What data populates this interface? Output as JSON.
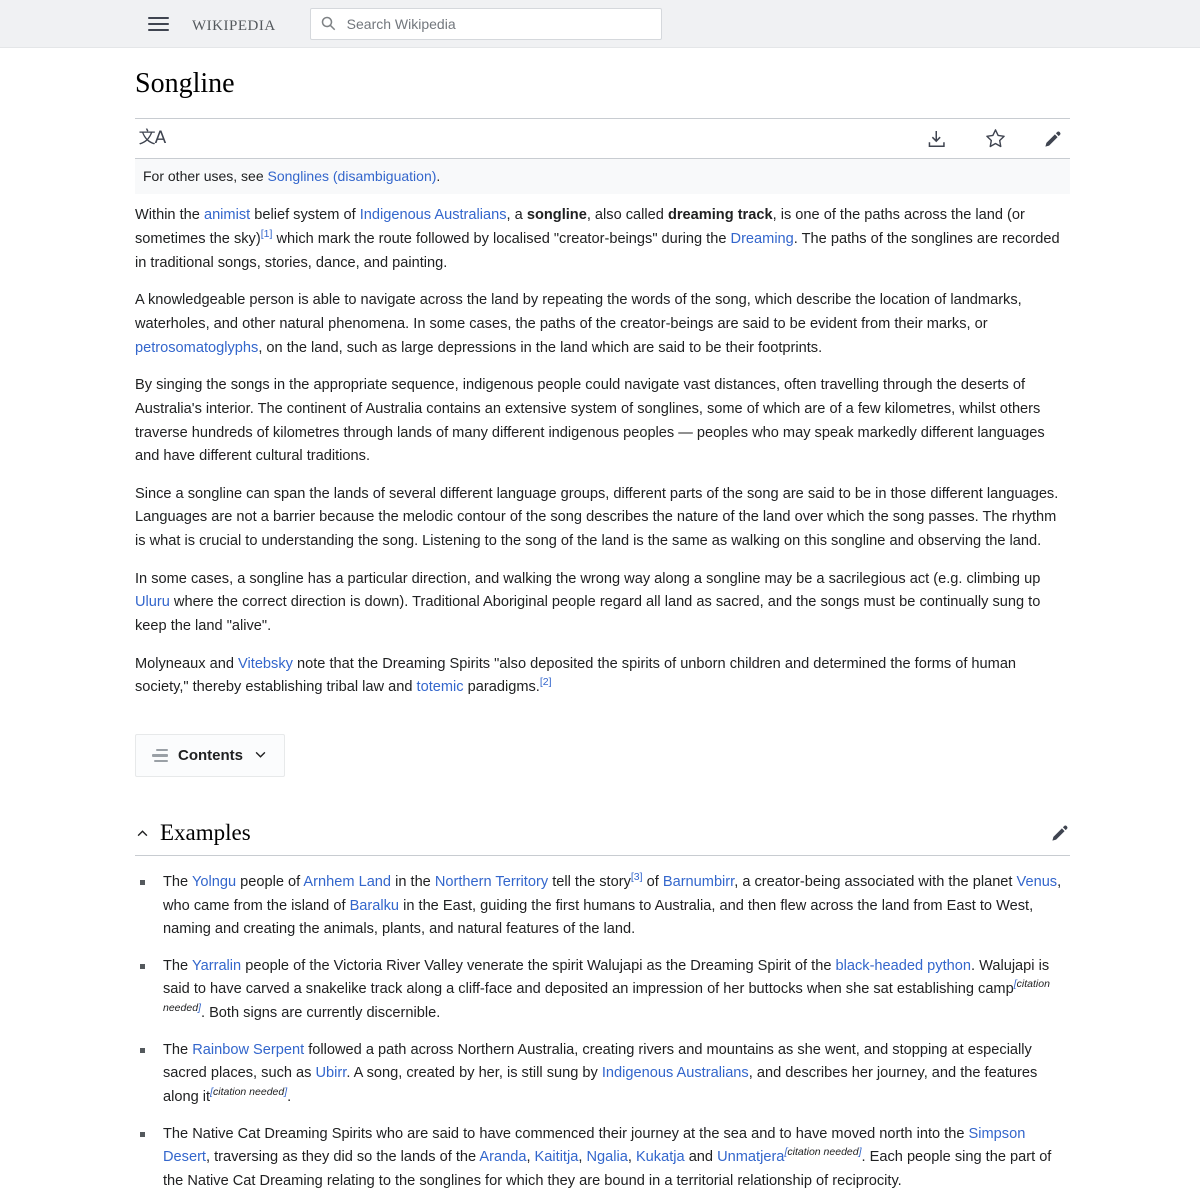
{
  "header": {
    "menu_icon": "hamburger-menu-icon",
    "wordmark": "Wikipedia",
    "search": {
      "icon": "search-icon",
      "placeholder": "Search Wikipedia",
      "value": ""
    }
  },
  "article": {
    "title": "Songline",
    "toolbar": {
      "language_button_label": "文A",
      "language_icon": "translate-language-icon",
      "download_icon": "download-icon",
      "watch_icon": "star-watch-icon",
      "edit_icon": "edit-pencil-icon"
    },
    "hatnote": {
      "prefix": "For other uses, see ",
      "link": "Songlines (disambiguation)",
      "suffix": "."
    },
    "paragraphs": [
      {
        "id": "lead",
        "segments": [
          {
            "t": "Within the ",
            "k": "text"
          },
          {
            "t": "animist",
            "k": "link"
          },
          {
            "t": " belief system of ",
            "k": "text"
          },
          {
            "t": "Indigenous Australians",
            "k": "link"
          },
          {
            "t": ", a ",
            "k": "text"
          },
          {
            "t": "songline",
            "k": "bold"
          },
          {
            "t": ", also called ",
            "k": "text"
          },
          {
            "t": "dreaming track",
            "k": "bold"
          },
          {
            "t": ", is one of the paths across the land (or sometimes the sky)",
            "k": "text"
          },
          {
            "t": "[1]",
            "k": "ref"
          },
          {
            "t": " which mark the route followed by localised \"creator-beings\" during the ",
            "k": "text"
          },
          {
            "t": "Dreaming",
            "k": "link"
          },
          {
            "t": ". The paths of the songlines are recorded in traditional songs, stories, dance, and painting.",
            "k": "text"
          }
        ]
      },
      {
        "id": "navigate",
        "segments": [
          {
            "t": "A knowledgeable person is able to navigate across the land by repeating the words of the song, which describe the location of landmarks, waterholes, and other natural phenomena. In some cases, the paths of the creator-beings are said to be evident from their marks, or ",
            "k": "text"
          },
          {
            "t": "petrosomatoglyphs",
            "k": "link"
          },
          {
            "t": ", on the land, such as large depressions in the land which are said to be their footprints.",
            "k": "text"
          }
        ]
      },
      {
        "id": "singing-sequence",
        "segments": [
          {
            "t": "By singing the songs in the appropriate sequence, indigenous people could navigate vast distances, often travelling through the deserts of Australia's interior. The continent of Australia contains an extensive system of songlines, some of which are of a few kilometres, whilst others traverse hundreds of kilometres through lands of many different indigenous peoples — peoples who may speak markedly different languages and have different cultural traditions.",
            "k": "text"
          }
        ]
      },
      {
        "id": "languages",
        "segments": [
          {
            "t": "Since a songline can span the lands of several different language groups, different parts of the song are said to be in those different languages. Languages are not a barrier because the melodic contour of the song describes the nature of the land over which the song passes. The rhythm is what is crucial to understanding the song. Listening to the song of the land is the same as walking on this songline and observing the land.",
            "k": "text"
          }
        ]
      },
      {
        "id": "direction",
        "segments": [
          {
            "t": "In some cases, a songline has a particular direction, and walking the wrong way along a songline may be a sacrilegious act (e.g. climbing up ",
            "k": "text"
          },
          {
            "t": "Uluru",
            "k": "link"
          },
          {
            "t": " where the correct direction is down). Traditional Aboriginal people regard all land as sacred, and the songs must be continually sung to keep the land \"alive\".",
            "k": "text"
          }
        ]
      },
      {
        "id": "molyneaux",
        "segments": [
          {
            "t": "Molyneaux and ",
            "k": "text"
          },
          {
            "t": "Vitebsky",
            "k": "link"
          },
          {
            "t": " note that the Dreaming Spirits \"also deposited the spirits of unborn children and determined the forms of human society,\" thereby establishing tribal law and ",
            "k": "text"
          },
          {
            "t": "totemic",
            "k": "link"
          },
          {
            "t": " paradigms.",
            "k": "text"
          },
          {
            "t": "[2]",
            "k": "ref"
          }
        ]
      }
    ],
    "contents": {
      "label": "Contents",
      "icon": "toc-list-icon",
      "chevron": "chevron-down-icon"
    },
    "section": {
      "title": "Examples",
      "collapse_icon": "chevron-up-icon",
      "edit_icon": "edit-pencil-icon",
      "items": [
        {
          "id": "yolngu",
          "segments": [
            {
              "t": "The ",
              "k": "text"
            },
            {
              "t": "Yolngu",
              "k": "link"
            },
            {
              "t": " people of ",
              "k": "text"
            },
            {
              "t": "Arnhem Land",
              "k": "link"
            },
            {
              "t": " in the ",
              "k": "text"
            },
            {
              "t": "Northern Territory",
              "k": "link"
            },
            {
              "t": " tell the story",
              "k": "text"
            },
            {
              "t": "[3]",
              "k": "ref"
            },
            {
              "t": " of ",
              "k": "text"
            },
            {
              "t": "Barnumbirr",
              "k": "link"
            },
            {
              "t": ", a creator-being associated with the planet ",
              "k": "text"
            },
            {
              "t": "Venus",
              "k": "link"
            },
            {
              "t": ", who came from the island of ",
              "k": "text"
            },
            {
              "t": "Baralku",
              "k": "link"
            },
            {
              "t": " in the East, guiding the first humans to Australia, and then flew across the land from East to West, naming and creating the animals, plants, and natural features of the land.",
              "k": "text"
            }
          ]
        },
        {
          "id": "yarralin",
          "segments": [
            {
              "t": "The ",
              "k": "text"
            },
            {
              "t": "Yarralin",
              "k": "link"
            },
            {
              "t": " people of the Victoria River Valley venerate the spirit Walujapi as the Dreaming Spirit of the ",
              "k": "text"
            },
            {
              "t": "black-headed python",
              "k": "link"
            },
            {
              "t": ". Walujapi is said to have carved a snakelike track along a cliff-face and deposited an impression of her buttocks when she sat establishing camp",
              "k": "text"
            },
            {
              "t": "[citation needed]",
              "k": "cn"
            },
            {
              "t": ". Both signs are currently discernible.",
              "k": "text"
            }
          ]
        },
        {
          "id": "rainbow-serpent",
          "segments": [
            {
              "t": "The ",
              "k": "text"
            },
            {
              "t": "Rainbow Serpent",
              "k": "link"
            },
            {
              "t": " followed a path across Northern Australia, creating rivers and mountains as she went, and stopping at especially sacred places, such as ",
              "k": "text"
            },
            {
              "t": "Ubirr",
              "k": "link"
            },
            {
              "t": ". A song, created by her, is still sung by ",
              "k": "text"
            },
            {
              "t": "Indigenous Australians",
              "k": "link"
            },
            {
              "t": ", and describes her journey, and the features along it",
              "k": "text"
            },
            {
              "t": "[citation needed]",
              "k": "cn"
            },
            {
              "t": ".",
              "k": "text"
            }
          ]
        },
        {
          "id": "native-cat",
          "segments": [
            {
              "t": "The Native Cat Dreaming Spirits who are said to have commenced their journey at the sea and to have moved north into the ",
              "k": "text"
            },
            {
              "t": "Simpson Desert",
              "k": "link"
            },
            {
              "t": ", traversing as they did so the lands of the ",
              "k": "text"
            },
            {
              "t": "Aranda",
              "k": "link"
            },
            {
              "t": ", ",
              "k": "text"
            },
            {
              "t": "Kaititja",
              "k": "link"
            },
            {
              "t": ", ",
              "k": "text"
            },
            {
              "t": "Ngalia",
              "k": "link"
            },
            {
              "t": ", ",
              "k": "text"
            },
            {
              "t": "Kukatja",
              "k": "link"
            },
            {
              "t": " and ",
              "k": "text"
            },
            {
              "t": "Unmatjera",
              "k": "link"
            },
            {
              "t": "[citation needed]",
              "k": "cn"
            },
            {
              "t": ". Each people sing the part of the Native Cat Dreaming relating to the songlines for which they are bound in a territorial relationship of reciprocity.",
              "k": "text"
            }
          ]
        }
      ]
    }
  },
  "colors": {
    "link": "#3366cc",
    "text": "#202122",
    "header_bg": "#f0f1f3",
    "hatnote_bg": "#f8f9fa",
    "rule": "#c8ccd1"
  }
}
